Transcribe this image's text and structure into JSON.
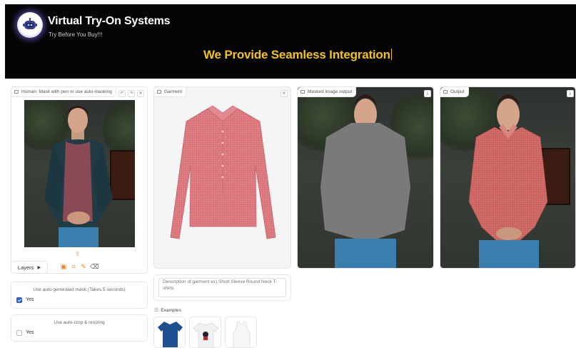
{
  "header": {
    "title": "Virtual Try-On Systems",
    "subtitle": "Try Before You Buy!!!",
    "tagline": "We Provide Seamless Integration"
  },
  "human_panel": {
    "label": "Human. Mask with pen or use auto-masking",
    "layers_label": "Layers"
  },
  "garment_panel": {
    "label": "Garment"
  },
  "masked_panel": {
    "label": "Masked image output"
  },
  "output_panel": {
    "label": "Output"
  },
  "options": {
    "auto_mask": {
      "label": "Use auto-generated mask (Takes 5 seconds)",
      "value_label": "Yes",
      "checked": true
    },
    "auto_crop": {
      "label": "Use auto-crop & resizing",
      "value_label": "Yes",
      "checked": false
    }
  },
  "description": {
    "placeholder": "Description of garment ex) Short Sleeve Round Neck T-shirts"
  },
  "examples": {
    "label": "Examples"
  },
  "colors": {
    "accent": "#f3c21b",
    "header_bg": "#050505",
    "garment": "#d9737a",
    "checkbox": "#2f5bd6",
    "icon_orange": "#f08b1e"
  },
  "icons": [
    "robot-logo-icon",
    "image-icon",
    "undo-icon",
    "redo-icon",
    "close-icon",
    "upload-icon",
    "image-tool-icon",
    "crop-icon",
    "brush-icon",
    "eraser-icon",
    "download-icon",
    "list-icon"
  ]
}
